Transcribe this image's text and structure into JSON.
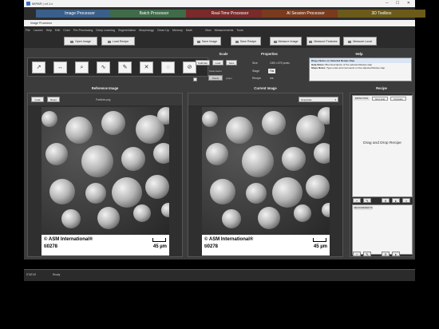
{
  "window": {
    "title": "MIPAR | v4.1.x"
  },
  "tabs": [
    {
      "label": "Image Processor",
      "color": "#3a5f8a"
    },
    {
      "label": "Batch Processor",
      "color": "#3f6b48"
    },
    {
      "label": "Real-Time Processor",
      "color": "#7a2a2a"
    },
    {
      "label": "AI Session Processor",
      "color": "#7a3a1e"
    },
    {
      "label": "3D Toolbox",
      "color": "#6b5a1a"
    }
  ],
  "inner_title": "Image Processor",
  "menu": [
    "File",
    "Launch",
    "Help",
    "Edit",
    "Color",
    "Pre-Processing",
    "Deep Learning",
    "Segmentation",
    "Morphology",
    "Clean Up",
    "Memory",
    "Math",
    "View",
    "Measurements",
    "Tools"
  ],
  "toolbar": {
    "open_image": "Open Image",
    "load_recipe": "Load Recipe",
    "save_image": "Save Image",
    "save_recipe": "Save Recipe",
    "measure_image": "Measure Image",
    "measure_features": "Measure Features",
    "measure_local": "Measure Local"
  },
  "tools": [
    "↗",
    "↔",
    "⌕",
    "∿",
    "✎",
    "✕",
    "◌",
    "⊘"
  ],
  "scale": {
    "title": "Scale",
    "calibrate": "Calibrate",
    "load": "Load",
    "save": "Save",
    "factor_label": "Scale Factor",
    "factor_value": "Pixels",
    "units": "px/µm"
  },
  "properties": {
    "title": "Properties",
    "rows": [
      {
        "k": "Size",
        "v": "1000 x 870 pixels"
      },
      {
        "k": "Stage",
        "v": "Flat"
      },
      {
        "k": "Recipe",
        "v": "n/a"
      }
    ]
  },
  "help": {
    "title": "Help",
    "header": "Drag a Notes on Selected Recipe Step",
    "rows": [
      {
        "k": "Help Notes:",
        "v": "Brief description of the selected Recipe step"
      },
      {
        "k": "Steps Notes:",
        "v": "Type notes and comments on the selected Recipe step"
      }
    ]
  },
  "reference": {
    "title": "Reference Image",
    "load": "Load",
    "reset": "Reset",
    "filename": "Particles.png"
  },
  "current": {
    "title": "Current Image",
    "dropdown": "Grayscale"
  },
  "micrograph": {
    "copyright": "© ASM International®",
    "id": "ti0278",
    "scale_label": "45 µm"
  },
  "recipe": {
    "title": "Recipe",
    "tabs": [
      "DETECTION",
      "Get Local",
      "Compare"
    ],
    "drop_text": "Drag and Drop Recipe",
    "measurements_label": "MEASUREMENTS"
  },
  "status": {
    "label": "STATUS",
    "text": "Ready"
  }
}
